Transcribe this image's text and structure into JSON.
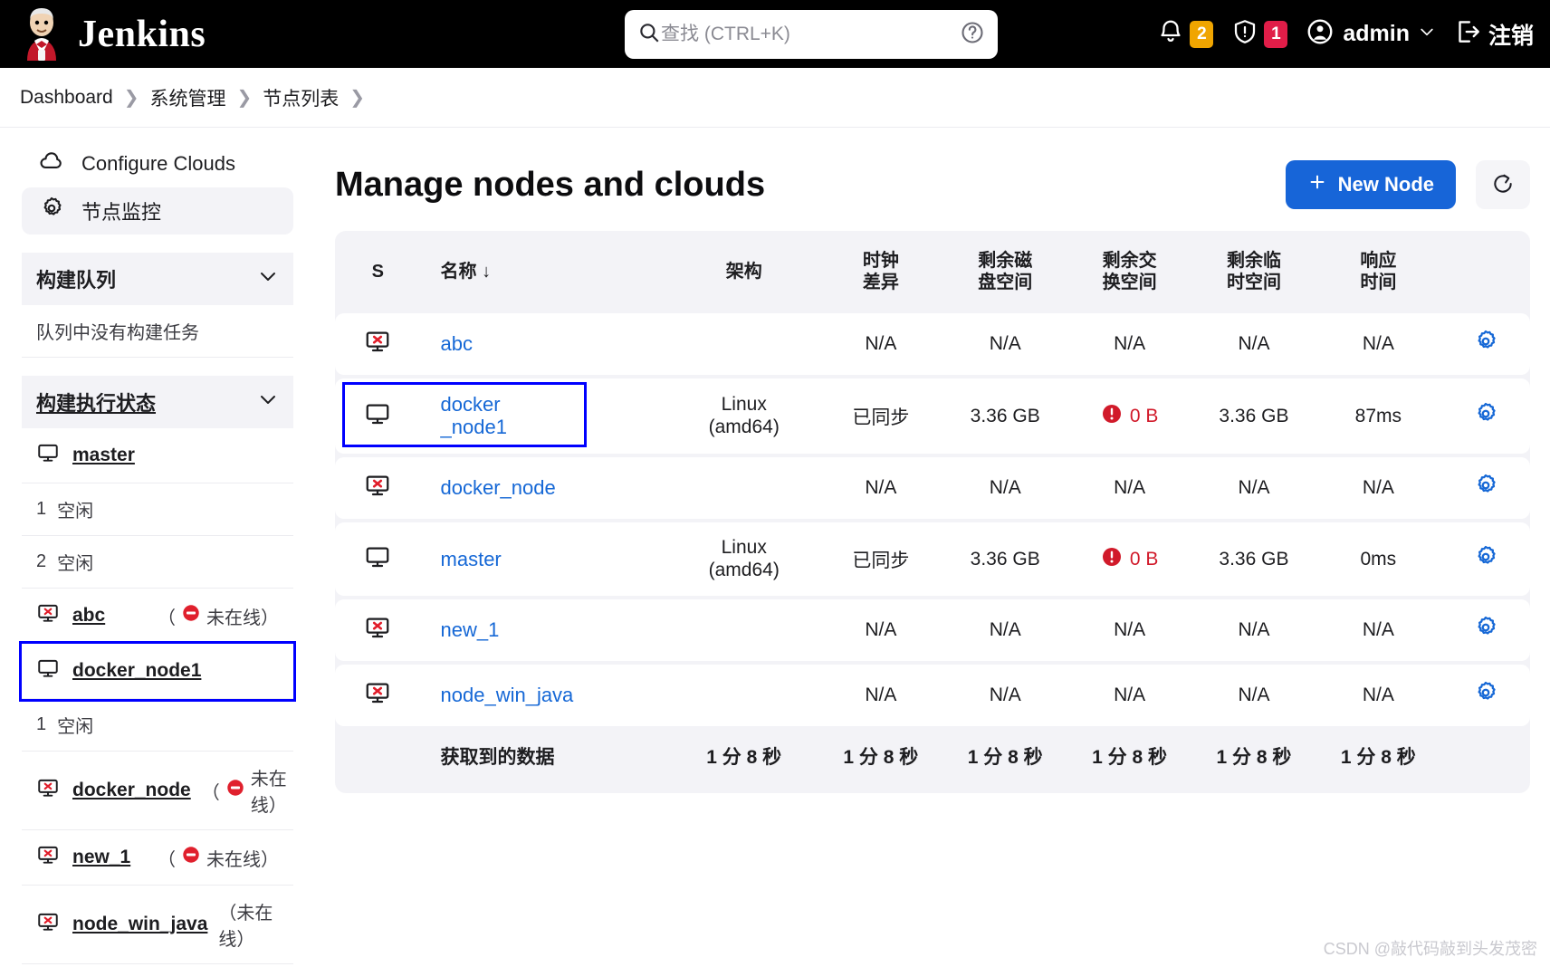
{
  "header": {
    "brand": "Jenkins",
    "logo_icon": "jenkins-butler-logo",
    "search": {
      "placeholder": "查找 (CTRL+K)",
      "value": "",
      "icon": "search-icon",
      "help_icon": "question-circle-icon"
    },
    "notifications": {
      "icon": "bell-icon",
      "count": "2",
      "color": "#f0a500"
    },
    "security": {
      "icon": "shield-warning-icon",
      "count": "1",
      "color": "#e11d48"
    },
    "user": {
      "icon": "user-circle-icon",
      "name": "admin",
      "chevron": "chevron-down-icon"
    },
    "logout": {
      "icon": "logout-icon",
      "label": "注销"
    }
  },
  "breadcrumb": {
    "items": [
      "Dashboard",
      "系统管理",
      "节点列表"
    ],
    "separator": "❯"
  },
  "sidebar": {
    "links": [
      {
        "label": "Configure Clouds",
        "icon": "cloud-icon",
        "active": false
      },
      {
        "label": "节点监控",
        "icon": "gear-icon",
        "active": true
      }
    ],
    "build_queue": {
      "title": "构建队列",
      "chevron": "chevron-down-icon",
      "empty_text": "队列中没有构建任务"
    },
    "executors": {
      "title": "构建执行状态",
      "chevron": "chevron-down-icon",
      "rows": [
        {
          "type": "node",
          "name": "master",
          "icon": "computer-icon",
          "status": ""
        },
        {
          "type": "executor",
          "index": "1",
          "state": "空闲"
        },
        {
          "type": "executor",
          "index": "2",
          "state": "空闲"
        },
        {
          "type": "node",
          "name": "abc",
          "icon": "computer-error-icon",
          "status": "（",
          "status_text": "未在线）",
          "offline_icon": "offline-icon"
        },
        {
          "type": "node",
          "name": "docker_node1",
          "icon": "computer-icon",
          "status": "",
          "selected": true
        },
        {
          "type": "executor",
          "index": "1",
          "state": "空闲"
        },
        {
          "type": "node",
          "name": "docker_node",
          "icon": "computer-error-icon",
          "status": "（",
          "status_text": "未在线）",
          "offline_icon": "offline-icon"
        },
        {
          "type": "node",
          "name": "new_1",
          "icon": "computer-error-icon",
          "status": "（",
          "status_text": "未在线）",
          "offline_icon": "offline-icon"
        },
        {
          "type": "node",
          "name": "node_win_java",
          "icon": "computer-error-icon",
          "status_plain": "（未在线）"
        }
      ]
    }
  },
  "main": {
    "title": "Manage nodes and clouds",
    "new_node_button": {
      "label": "New Node",
      "icon": "plus-icon"
    },
    "refresh_button": {
      "icon": "refresh-icon"
    },
    "table": {
      "columns": [
        {
          "key": "s",
          "label": "S"
        },
        {
          "key": "name",
          "label": "名称 ↓"
        },
        {
          "key": "arch",
          "label": "架构"
        },
        {
          "key": "clock",
          "label": "时钟\n差异"
        },
        {
          "key": "disk",
          "label": "剩余磁\n盘空间"
        },
        {
          "key": "swap",
          "label": "剩余交\n换空间"
        },
        {
          "key": "temp",
          "label": "剩余临\n时空间"
        },
        {
          "key": "resp",
          "label": "响应\n时间"
        },
        {
          "key": "gear",
          "label": ""
        }
      ],
      "rows": [
        {
          "status_icon": "computer-error-icon",
          "name": "abc",
          "arch": "",
          "clock": "N/A",
          "disk": "N/A",
          "swap": "N/A",
          "swap_warn": false,
          "temp": "N/A",
          "resp": "N/A",
          "gear_icon": "gear-icon",
          "selected": false
        },
        {
          "status_icon": "computer-icon",
          "name": "docker\n_node1",
          "arch": "Linux\n(amd64)",
          "clock": "已同步",
          "disk": "3.36 GB",
          "swap": "0 B",
          "swap_warn": true,
          "temp": "3.36 GB",
          "resp": "87ms",
          "gear_icon": "gear-icon",
          "selected": true
        },
        {
          "status_icon": "computer-error-icon",
          "name": "docker_node",
          "arch": "",
          "clock": "N/A",
          "disk": "N/A",
          "swap": "N/A",
          "swap_warn": false,
          "temp": "N/A",
          "resp": "N/A",
          "gear_icon": "gear-icon",
          "selected": false
        },
        {
          "status_icon": "computer-icon",
          "name": "master",
          "arch": "Linux\n(amd64)",
          "clock": "已同步",
          "disk": "3.36 GB",
          "swap": "0 B",
          "swap_warn": true,
          "temp": "3.36 GB",
          "resp": "0ms",
          "gear_icon": "gear-icon",
          "selected": false
        },
        {
          "status_icon": "computer-error-icon",
          "name": "new_1",
          "arch": "",
          "clock": "N/A",
          "disk": "N/A",
          "swap": "N/A",
          "swap_warn": false,
          "temp": "N/A",
          "resp": "N/A",
          "gear_icon": "gear-icon",
          "selected": false
        },
        {
          "status_icon": "computer-error-icon",
          "name": "node_win_java",
          "arch": "",
          "clock": "N/A",
          "disk": "N/A",
          "swap": "N/A",
          "swap_warn": false,
          "temp": "N/A",
          "resp": "N/A",
          "gear_icon": "gear-icon",
          "selected": false
        }
      ],
      "footer": {
        "label": "获取到的数据",
        "values": [
          "1 分 8 秒",
          "1 分 8 秒",
          "1 分 8 秒",
          "1 分 8 秒",
          "1 分 8 秒",
          "1 分 8 秒"
        ]
      }
    }
  },
  "watermark": "CSDN @敲代码敲到头发茂密"
}
